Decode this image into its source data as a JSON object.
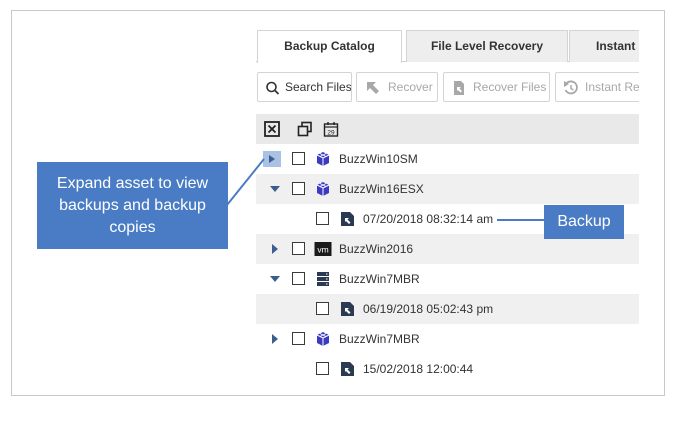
{
  "tabs": [
    {
      "label": "Backup Catalog",
      "active": true
    },
    {
      "label": "File Level Recovery",
      "active": false
    },
    {
      "label": "Instant",
      "active": false
    }
  ],
  "toolbar": {
    "search_label": "Search Files",
    "recover_label": "Recover",
    "recover_files_label": "Recover Files",
    "instant_label": "Instant Re"
  },
  "header_icons": [
    "close-box-icon",
    "copy-icon",
    "calendar-icon"
  ],
  "calendar_day": "29",
  "rows": [
    {
      "label": "BuzzWin10SM",
      "type": "asset",
      "expanded": false,
      "icon": "cube-icon"
    },
    {
      "label": "BuzzWin16ESX",
      "type": "asset",
      "expanded": true,
      "icon": "cube-icon"
    },
    {
      "label": "07/20/2018 08:32:14 am",
      "type": "backup",
      "icon": "backup-file-icon"
    },
    {
      "label": "BuzzWin2016",
      "type": "asset",
      "expanded": false,
      "icon": "vm-icon",
      "icon_text": "vm"
    },
    {
      "label": "BuzzWin7MBR",
      "type": "asset",
      "expanded": true,
      "icon": "server-icon"
    },
    {
      "label": "06/19/2018 05:02:43 pm",
      "type": "backup",
      "icon": "backup-file-icon"
    },
    {
      "label": "BuzzWin7MBR",
      "type": "asset",
      "expanded": false,
      "icon": "cube-icon"
    },
    {
      "label": "15/02/2018 12:00:44",
      "type": "backup",
      "icon": "backup-file-icon"
    }
  ],
  "callouts": {
    "expand": "Expand asset to view backups and backup copies",
    "backup": "Backup"
  },
  "colors": {
    "callout": "#4a7cc6",
    "expander": "#3d5d8c",
    "asset_icon": "#3b3bc2",
    "highlight": "#aac1e6"
  }
}
